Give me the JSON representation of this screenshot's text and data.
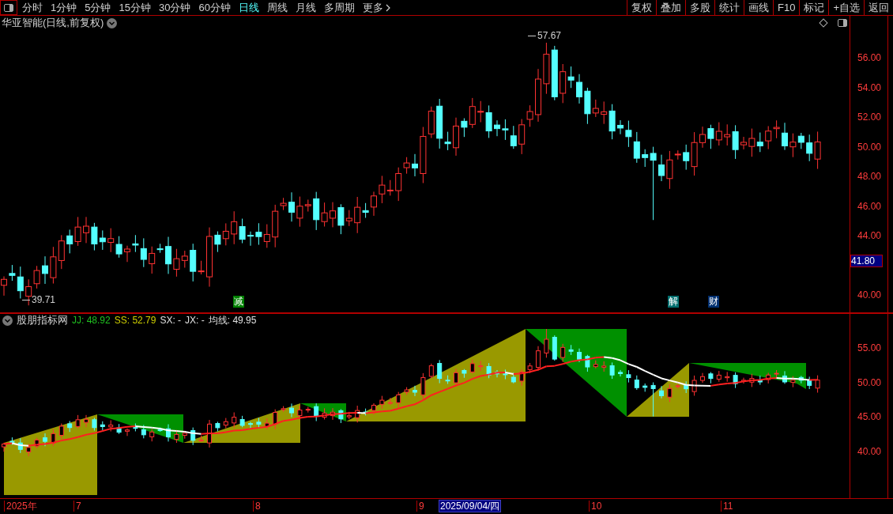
{
  "toolbar": {
    "periods": [
      {
        "label": "分时",
        "selected": false
      },
      {
        "label": "1分钟",
        "selected": false
      },
      {
        "label": "5分钟",
        "selected": false
      },
      {
        "label": "15分钟",
        "selected": false
      },
      {
        "label": "30分钟",
        "selected": false
      },
      {
        "label": "60分钟",
        "selected": false
      },
      {
        "label": "日线",
        "selected": true
      },
      {
        "label": "周线",
        "selected": false
      },
      {
        "label": "月线",
        "selected": false
      },
      {
        "label": "多周期",
        "selected": false
      }
    ],
    "more": "更多",
    "buttons": [
      "复权",
      "叠加",
      "多股",
      "统计",
      "画线",
      "F10",
      "标记",
      "+自选",
      "返回"
    ]
  },
  "main_chart": {
    "title": "华亚智能(日线,前复权)",
    "high_label": "57.67",
    "low_label": "39.71",
    "events": [
      {
        "label": "减",
        "color": "#008000"
      },
      {
        "label": "解",
        "color": "#006e6e"
      },
      {
        "label": "财",
        "color": "#003070"
      }
    ],
    "y_ticks": [
      "56.00",
      "54.00",
      "52.00",
      "50.00",
      "48.00",
      "46.00",
      "44.00",
      "40.00"
    ],
    "current_price": "41.80"
  },
  "indicator": {
    "name": "股朋指标网",
    "values": [
      {
        "label": "JJ: 48.92",
        "color": "#20c020"
      },
      {
        "label": "SS: 52.79",
        "color": "#d0d000"
      },
      {
        "label": "SX: -",
        "color": "#e0e0e0"
      },
      {
        "label": "JX: -",
        "color": "#e0e0e0"
      },
      {
        "label": "均线: 49.95",
        "color": "#e0e0e0"
      }
    ],
    "y_ticks": [
      "55.00",
      "50.00",
      "45.00",
      "40.00"
    ]
  },
  "time_axis": [
    {
      "label": "2025年",
      "highlighted": false
    },
    {
      "label": "7",
      "highlighted": false
    },
    {
      "label": "8",
      "highlighted": false
    },
    {
      "label": "9",
      "highlighted": false
    },
    {
      "label": "2025/09/04/四",
      "highlighted": true
    },
    {
      "label": "10",
      "highlighted": false
    },
    {
      "label": "11",
      "highlighted": false
    }
  ]
}
